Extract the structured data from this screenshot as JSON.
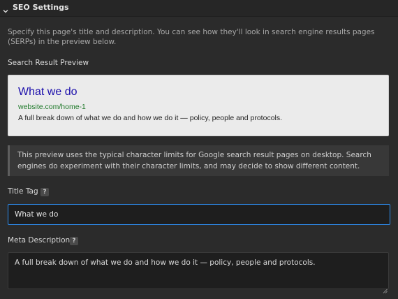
{
  "header": {
    "title": "SEO Settings",
    "toggle_icon": "chevron-down-icon"
  },
  "intro": {
    "text": "Specify this page's title and description. You can see how they'll look in search engine results pages (SERPs) in the preview below."
  },
  "preview": {
    "label": "Search Result Preview",
    "title": "What we do",
    "url": "website.com/home-1",
    "description": "A full break down of what we do and how we do it — policy, people and protocols.",
    "colors": {
      "title": "#1a0dab",
      "url": "#207a2b",
      "background": "#ebebeb"
    }
  },
  "note": {
    "text": "This preview uses the typical character limits for Google search result pages on desktop. Search engines do experiment with their character limits, and may decide to show different content."
  },
  "title_tag": {
    "label": "Title Tag",
    "help": "?",
    "value": "What we do"
  },
  "meta_description": {
    "label": "Meta Description",
    "help": "?",
    "value": "A full break down of what we do and how we do it — policy, people and protocols."
  },
  "colors": {
    "panel_bg": "#2b2b2b",
    "input_bg": "#1e1e1e",
    "focus_border": "#2e8ef2"
  }
}
